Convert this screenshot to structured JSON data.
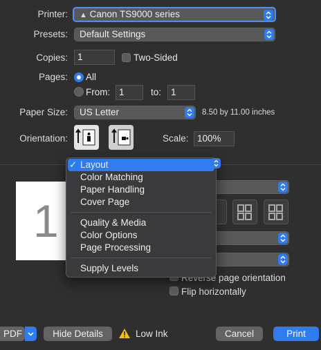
{
  "printer": {
    "label": "Printer:",
    "value": "Canon TS9000 series"
  },
  "presets": {
    "label": "Presets:",
    "value": "Default Settings"
  },
  "copies": {
    "label": "Copies:",
    "value": "1",
    "two_sided": "Two-Sided"
  },
  "pages": {
    "label": "Pages:",
    "all": "All",
    "from": "From:",
    "from_value": "1",
    "to": "to:",
    "to_value": "1"
  },
  "paper_size": {
    "label": "Paper Size:",
    "value": "US Letter",
    "dimensions": "8.50 by 11.00 inches"
  },
  "orientation": {
    "label": "Orientation:"
  },
  "scale": {
    "label": "Scale:",
    "value": "100%"
  },
  "preview": {
    "page_number": "1"
  },
  "menu": {
    "items": [
      "Layout",
      "Color Matching",
      "Paper Handling",
      "Cover Page",
      "Quality & Media",
      "Color Options",
      "Page Processing",
      "Supply Levels"
    ],
    "checkmark": "✓"
  },
  "layout_options": {
    "reverse_orientation": "Reverse page orientation",
    "flip_horizontally": "Flip horizontally"
  },
  "footer": {
    "pdf": "PDF",
    "hide_details": "Hide Details",
    "low_ink": "Low Ink",
    "cancel": "Cancel",
    "print": "Print"
  },
  "colors": {
    "accent": "#2f7bf0",
    "background": "#2f2f2f",
    "warning": "#f4c20d"
  }
}
